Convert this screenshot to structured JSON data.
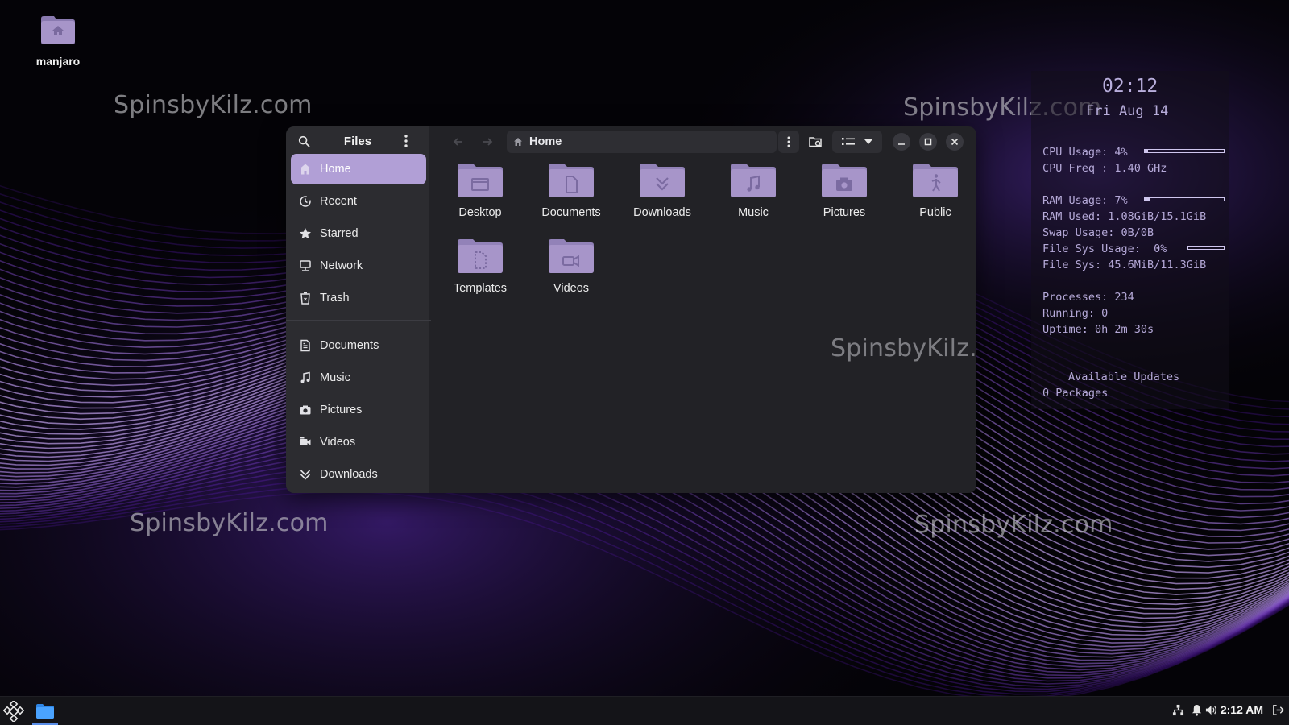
{
  "watermark": "SpinsbyKilz.com",
  "desktop": {
    "home_label": "manjaro"
  },
  "conky": {
    "time": "02:12",
    "date": "Fri Aug 14",
    "cpu_usage": "CPU Usage: 4%",
    "cpu_usage_pct": 4,
    "cpu_freq": "CPU Freq : 1.40 GHz",
    "ram_usage": "RAM Usage: 7%",
    "ram_usage_pct": 7,
    "ram_used": "RAM Used: 1.08GiB/15.1GiB",
    "swap_usage": "Swap Usage: 0B/0B",
    "fs_usage": "File Sys Usage:  0%",
    "fs_usage_pct": 0,
    "fs": "File Sys: 45.6MiB/11.3GiB",
    "processes": "Processes: 234",
    "running": "Running: 0",
    "uptime": "Uptime: 0h 2m 30s",
    "updates_title": "Available Updates",
    "updates_count": "0 Packages"
  },
  "window": {
    "app_title": "Files",
    "path": "Home",
    "sidebar": {
      "places": [
        {
          "label": "Home",
          "icon": "home-icon",
          "active": true
        },
        {
          "label": "Recent",
          "icon": "clock-icon"
        },
        {
          "label": "Starred",
          "icon": "star-icon"
        },
        {
          "label": "Network",
          "icon": "network-icon"
        },
        {
          "label": "Trash",
          "icon": "trash-icon"
        }
      ],
      "bookmarks": [
        {
          "label": "Documents",
          "icon": "document-icon"
        },
        {
          "label": "Music",
          "icon": "music-icon"
        },
        {
          "label": "Pictures",
          "icon": "camera-icon"
        },
        {
          "label": "Videos",
          "icon": "video-icon"
        },
        {
          "label": "Downloads",
          "icon": "download-icon"
        }
      ]
    },
    "folders": [
      {
        "name": "Desktop",
        "icon": "desktop-folder-icon"
      },
      {
        "name": "Documents",
        "icon": "documents-folder-icon"
      },
      {
        "name": "Downloads",
        "icon": "downloads-folder-icon"
      },
      {
        "name": "Music",
        "icon": "music-folder-icon"
      },
      {
        "name": "Pictures",
        "icon": "pictures-folder-icon"
      },
      {
        "name": "Public",
        "icon": "public-folder-icon"
      },
      {
        "name": "Templates",
        "icon": "templates-folder-icon"
      },
      {
        "name": "Videos",
        "icon": "videos-folder-icon"
      }
    ]
  },
  "colors": {
    "accent": "#b19fd6",
    "folder_fill": "#a795c9",
    "folder_tab": "#9282b8",
    "window_bg": "#222226",
    "sidebar_bg": "#2c2c30"
  },
  "taskbar": {
    "clock": "2:12 AM"
  }
}
